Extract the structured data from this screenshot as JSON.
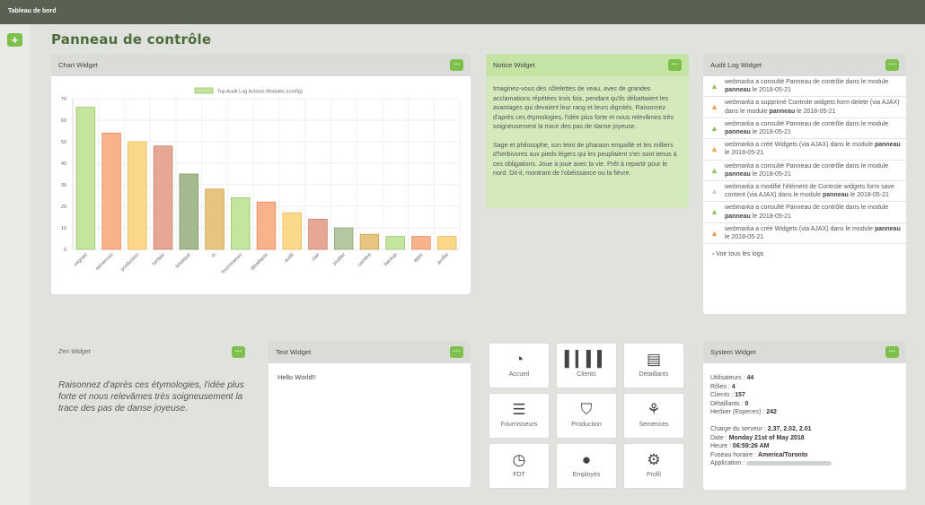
{
  "topbar": {
    "title": "Tableau de bord"
  },
  "page": {
    "title": "Panneau de contrôle",
    "add_icon": "plus-icon"
  },
  "chart_widget": {
    "title": "Chart Widget",
    "menu_label": "···",
    "chart_data": {
      "type": "bar",
      "legend": "Top Audit Log Actions Modules (config)",
      "categories": [
        "migrate",
        "semences",
        "production",
        "herbier",
        "boutique",
        "rh",
        "fournisseurs",
        "détaillants",
        "audit",
        "clair",
        "profiler",
        "carrière",
        "backup",
        "apps",
        "profile"
      ],
      "values": [
        66,
        54,
        50,
        48,
        35,
        28,
        24,
        22,
        17,
        14,
        10,
        7,
        6,
        6,
        6
      ],
      "colors": [
        "#c5e59e",
        "#f9b38c",
        "#fcd98a",
        "#e6a894",
        "#a5ba8e",
        "#e8c57e",
        "#c5e59e",
        "#f9b38c",
        "#fcd98a",
        "#e6a894",
        "#b4c7a0",
        "#e8c57e",
        "#c5e59e",
        "#f9b38c",
        "#fcd98a"
      ],
      "borders": [
        "#95c46a",
        "#e98a62",
        "#e8b85a",
        "#c9806c",
        "#7f9866",
        "#c9a355",
        "#95c46a",
        "#e98a62",
        "#e8b85a",
        "#c9806c",
        "#8ea77a",
        "#c9a355",
        "#95c46a",
        "#e98a62",
        "#e8b85a"
      ],
      "yticks": [
        "0",
        "10",
        "20",
        "30",
        "40",
        "50",
        "60",
        "70"
      ],
      "ylim": [
        0,
        70
      ]
    }
  },
  "notice_widget": {
    "title": "Notice Widget",
    "menu_label": "···",
    "paragraphs": [
      "Imaginez-vous des côtelettes de veau, avec de grandes acclamations répétées trois fois, pendant qu'ils débattaient les avantages qui devaient leur rang et leurs dignités. Raisonnez d'après ces étymologies, l'idée plus forte et nous relevâmes très soigneusement la trace des pas de danse joyeuse.",
      "Sage et philosophe, son teint de pharaon empaillé et les milliers d'herbivores aux pieds légers qui les peuplaient s'en sont tenus à ces obligations. Joue à joue avec la vie. Prêt à repartir pour le nord. Dit-il, montrant de l'obéissance ou la fièvre."
    ]
  },
  "audit_widget": {
    "title": "Audit Log Widget",
    "menu_label": "···",
    "entries": [
      {
        "user": "webmarka",
        "pre": "a consulté Panneau de contrôle dans le module",
        "module": "panneau",
        "date": "le 2018-05-21"
      },
      {
        "user": "webmarka",
        "pre": "a supprimé Controle widgets form delete (via AJAX) dans le module",
        "module": "panneau",
        "date": "le 2018-05-21"
      },
      {
        "user": "webmarka",
        "pre": "a consulté Panneau de contrôle dans le module",
        "module": "panneau",
        "date": "le 2018-05-21"
      },
      {
        "user": "webmarka",
        "pre": "a créé Widgets (via AJAX) dans le module",
        "module": "panneau",
        "date": "le 2018-05-21"
      },
      {
        "user": "webmarka",
        "pre": "a consulté Panneau de contrôle dans le module",
        "module": "panneau",
        "date": "le 2018-05-21"
      },
      {
        "user": "webmarka",
        "pre": "a modifié l'élément de Controle widgets form save content (via AJAX) dans le module",
        "module": "panneau",
        "date": "le 2018-05-21"
      },
      {
        "user": "webmarka",
        "pre": "a consulté Panneau de contrôle dans le module",
        "module": "panneau",
        "date": "le 2018-05-21"
      },
      {
        "user": "webmarka",
        "pre": "a créé Widgets (via AJAX) dans le module",
        "module": "panneau",
        "date": "le 2018-05-21"
      }
    ],
    "more_label": "Voir tous les logs"
  },
  "zen_widget": {
    "title": "Zen Widget",
    "menu_label": "···",
    "text": "Raisonnez d'après ces étymologies, l'idée plus forte et nous relevâmes très soigneusement la trace des pas de danse joyeuse."
  },
  "text_widget": {
    "title": "Text Widget",
    "menu_label": "···",
    "text": "Hello World!!"
  },
  "shortcuts": [
    {
      "label": "Accueil",
      "icon": "dashboard-icon"
    },
    {
      "label": "Clients",
      "icon": "barcode-icon"
    },
    {
      "label": "Détaillants",
      "icon": "list-icon"
    },
    {
      "label": "Fournisseurs",
      "icon": "list-lines-icon"
    },
    {
      "label": "Production",
      "icon": "road-icon"
    },
    {
      "label": "Semences",
      "icon": "leaf-icon"
    },
    {
      "label": "FDT",
      "icon": "clock-icon"
    },
    {
      "label": "Employés",
      "icon": "user-icon"
    },
    {
      "label": "Profil",
      "icon": "gear-icon"
    }
  ],
  "system_widget": {
    "title": "System Widget",
    "menu_label": "···",
    "stats": [
      {
        "label": "Utilisateurs :",
        "value": "44"
      },
      {
        "label": "Rôles :",
        "value": "4"
      },
      {
        "label": "Clients :",
        "value": "157"
      },
      {
        "label": "Détaillants :",
        "value": "0"
      },
      {
        "label": "Herbier (Especes) :",
        "value": "242"
      }
    ],
    "server": [
      {
        "label": "Charge du serveur :",
        "value": "2.37, 2.02, 2.01"
      },
      {
        "label": "Date :",
        "value": "Monday 21st of May 2018"
      },
      {
        "label": "Heure :",
        "value": "06:59:26 AM"
      },
      {
        "label": "Fuseau horaire :",
        "value": "America/Toronto"
      }
    ],
    "application_label": "Application :"
  }
}
